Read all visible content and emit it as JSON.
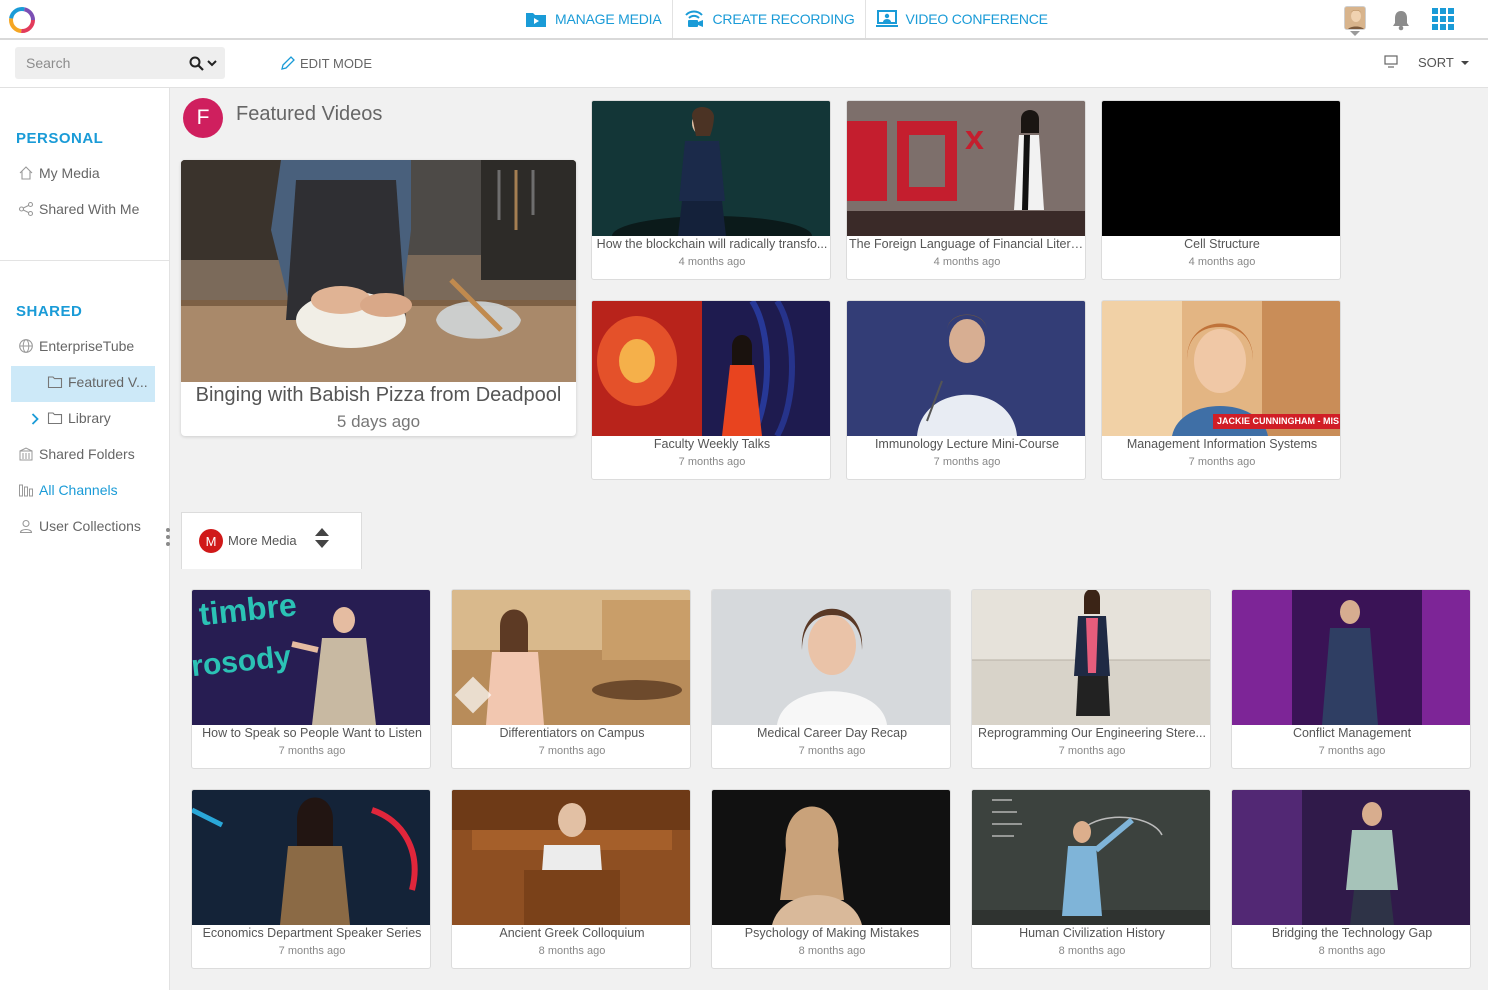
{
  "topnav": {
    "items": [
      {
        "label": "MANAGE MEDIA",
        "icon": "folder-media-icon"
      },
      {
        "label": "CREATE RECORDING",
        "icon": "broadcast-icon"
      },
      {
        "label": "VIDEO CONFERENCE",
        "icon": "conference-icon"
      }
    ]
  },
  "toolbar": {
    "search_placeholder": "Search",
    "edit_mode_label": "EDIT MODE",
    "sort_label": "SORT"
  },
  "sidebar": {
    "personal_heading": "PERSONAL",
    "personal_items": [
      {
        "label": "My Media",
        "icon": "home-icon"
      },
      {
        "label": "Shared With Me",
        "icon": "share-icon"
      }
    ],
    "shared_heading": "SHARED",
    "shared_items": [
      {
        "label": "EnterpriseTube",
        "icon": "globe-icon"
      },
      {
        "label": "Featured V...",
        "icon": "folder-icon"
      },
      {
        "label": "Library",
        "icon": "folder-icon"
      },
      {
        "label": "Shared Folders",
        "icon": "building-icon"
      },
      {
        "label": "All Channels",
        "icon": "channels-icon"
      },
      {
        "label": "User Collections",
        "icon": "user-icon"
      }
    ]
  },
  "featured": {
    "avatar_letter": "F",
    "title": "Featured Videos",
    "hero": {
      "title": "Binging with Babish Pizza from Deadpool",
      "date": "5 days ago"
    },
    "cards": [
      {
        "title": "How the blockchain will radically transfo...",
        "date": "4 months ago"
      },
      {
        "title": "The Foreign Language of Financial Litera...",
        "date": "4 months ago"
      },
      {
        "title": "Cell Structure",
        "date": "4 months ago"
      },
      {
        "title": "Faculty Weekly Talks",
        "date": "7 months ago"
      },
      {
        "title": "Immunology Lecture Mini-Course",
        "date": "7 months ago"
      },
      {
        "title": "Management Information Systems",
        "date": "7 months ago",
        "overlay": "JACKIE CUNNINGHAM - MIS MAJOR"
      }
    ]
  },
  "more_media": {
    "avatar_letter": "M",
    "label": "More Media",
    "cards": [
      {
        "title": "How to Speak so People Want to Listen",
        "date": "7 months ago"
      },
      {
        "title": "Differentiators on Campus",
        "date": "7 months ago"
      },
      {
        "title": "Medical Career Day Recap",
        "date": "7 months ago"
      },
      {
        "title": "Reprogramming Our Engineering Stere...",
        "date": "7 months ago"
      },
      {
        "title": "Conflict Management",
        "date": "7 months ago"
      },
      {
        "title": "Economics Department Speaker Series",
        "date": "7 months ago"
      },
      {
        "title": "Ancient Greek Colloquium",
        "date": "8 months ago"
      },
      {
        "title": "Psychology of Making Mistakes",
        "date": "8 months ago"
      },
      {
        "title": "Human Civilization History",
        "date": "8 months ago"
      },
      {
        "title": "Bridging the Technology Gap",
        "date": "8 months ago"
      }
    ]
  },
  "colors": {
    "accent": "#1a9bd7",
    "featured_avatar": "#cf1f5e",
    "more_avatar": "#d01919",
    "selected_bg": "#cde9f8"
  }
}
